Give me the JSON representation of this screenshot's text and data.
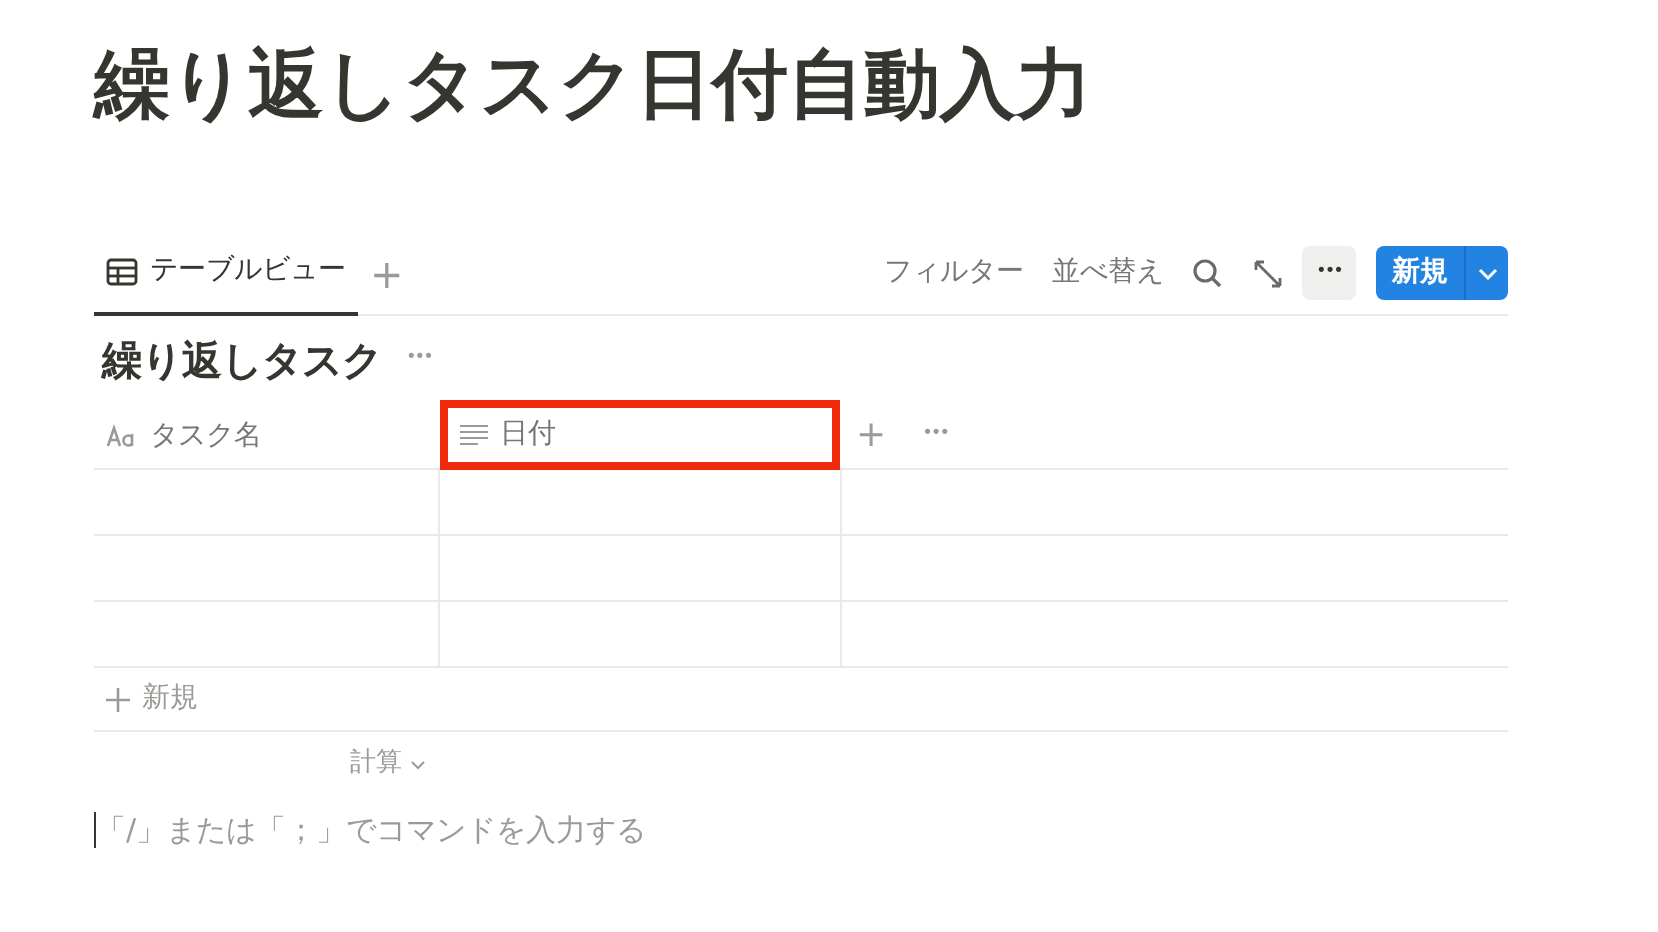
{
  "page_title": "繰り返しタスク日付自動入力",
  "views": [
    {
      "label": "テーブルビュー",
      "selected": true
    }
  ],
  "add_view": "+",
  "toolbar": {
    "filter": "フィルター",
    "sort": "並べ替え",
    "more": "•••",
    "new_button": "新規"
  },
  "database_title": "繰り返しタスク",
  "database_more": "•••",
  "table": {
    "columns": [
      {
        "label": "タスク名",
        "kind": "title",
        "highlighted": false
      },
      {
        "label": "日付",
        "kind": "text",
        "highlighted": true
      }
    ],
    "add_column": "+",
    "column_more": "•••",
    "rows": [
      [
        "",
        ""
      ],
      [
        "",
        ""
      ],
      [
        "",
        ""
      ]
    ],
    "new_row": "新規",
    "calculate": "計算"
  },
  "command_placeholder": "「/」または「；」でコマンドを入力する"
}
